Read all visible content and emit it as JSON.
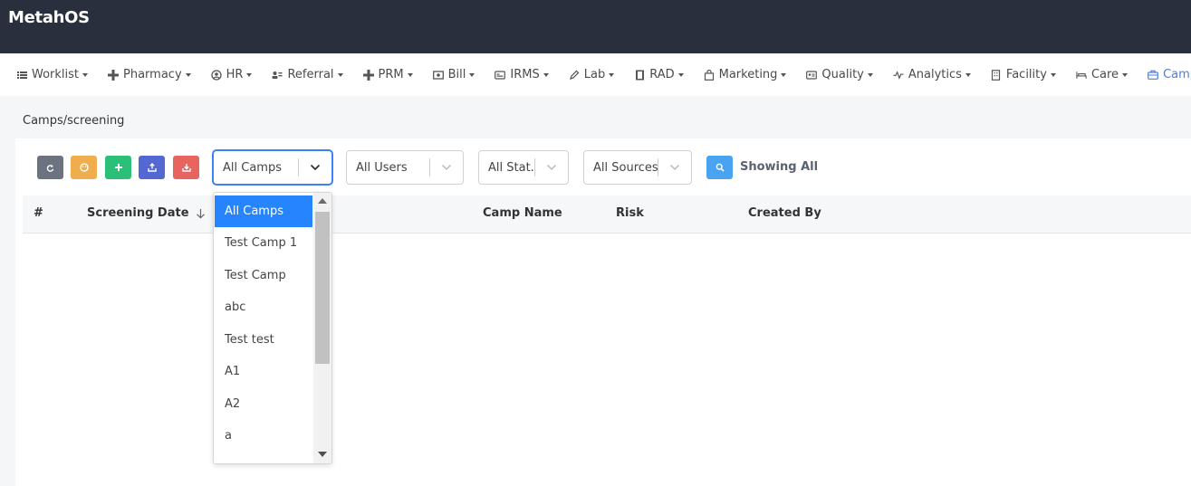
{
  "app": {
    "title": "MetahOS"
  },
  "nav": [
    {
      "label": "Worklist",
      "icon": "list-icon"
    },
    {
      "label": "Pharmacy",
      "icon": "plus-icon"
    },
    {
      "label": "HR",
      "icon": "user-circle-icon"
    },
    {
      "label": "Referral",
      "icon": "users-icon"
    },
    {
      "label": "PRM",
      "icon": "plus-icon"
    },
    {
      "label": "Bill",
      "icon": "money-icon"
    },
    {
      "label": "IRMS",
      "icon": "id-card-icon"
    },
    {
      "label": "Lab",
      "icon": "pen-icon"
    },
    {
      "label": "RAD",
      "icon": "film-icon"
    },
    {
      "label": "Marketing",
      "icon": "bag-icon"
    },
    {
      "label": "Quality",
      "icon": "address-card-icon"
    },
    {
      "label": "Analytics",
      "icon": "pulse-icon"
    },
    {
      "label": "Facility",
      "icon": "building-icon"
    },
    {
      "label": "Care",
      "icon": "bed-icon"
    },
    {
      "label": "Camps",
      "icon": "briefcase-icon",
      "active": true
    }
  ],
  "breadcrumb": "Camps/screening",
  "filters": {
    "camps": "All Camps",
    "users": "All Users",
    "status": "All Stat...",
    "sources": "All Sources"
  },
  "showing_label": "Showing All",
  "table": {
    "columns": [
      "#",
      "Screening Date",
      "Camp Name",
      "Risk",
      "Created By"
    ]
  },
  "dropdown": {
    "options": [
      "All Camps",
      "Test Camp 1",
      "Test Camp",
      "abc",
      "Test test",
      "A1",
      "A2",
      "a"
    ],
    "selected_index": 0
  },
  "colors": {
    "accent": "#2684ff",
    "topbar": "#2a2f3d",
    "active_nav": "#4a7fd8"
  }
}
